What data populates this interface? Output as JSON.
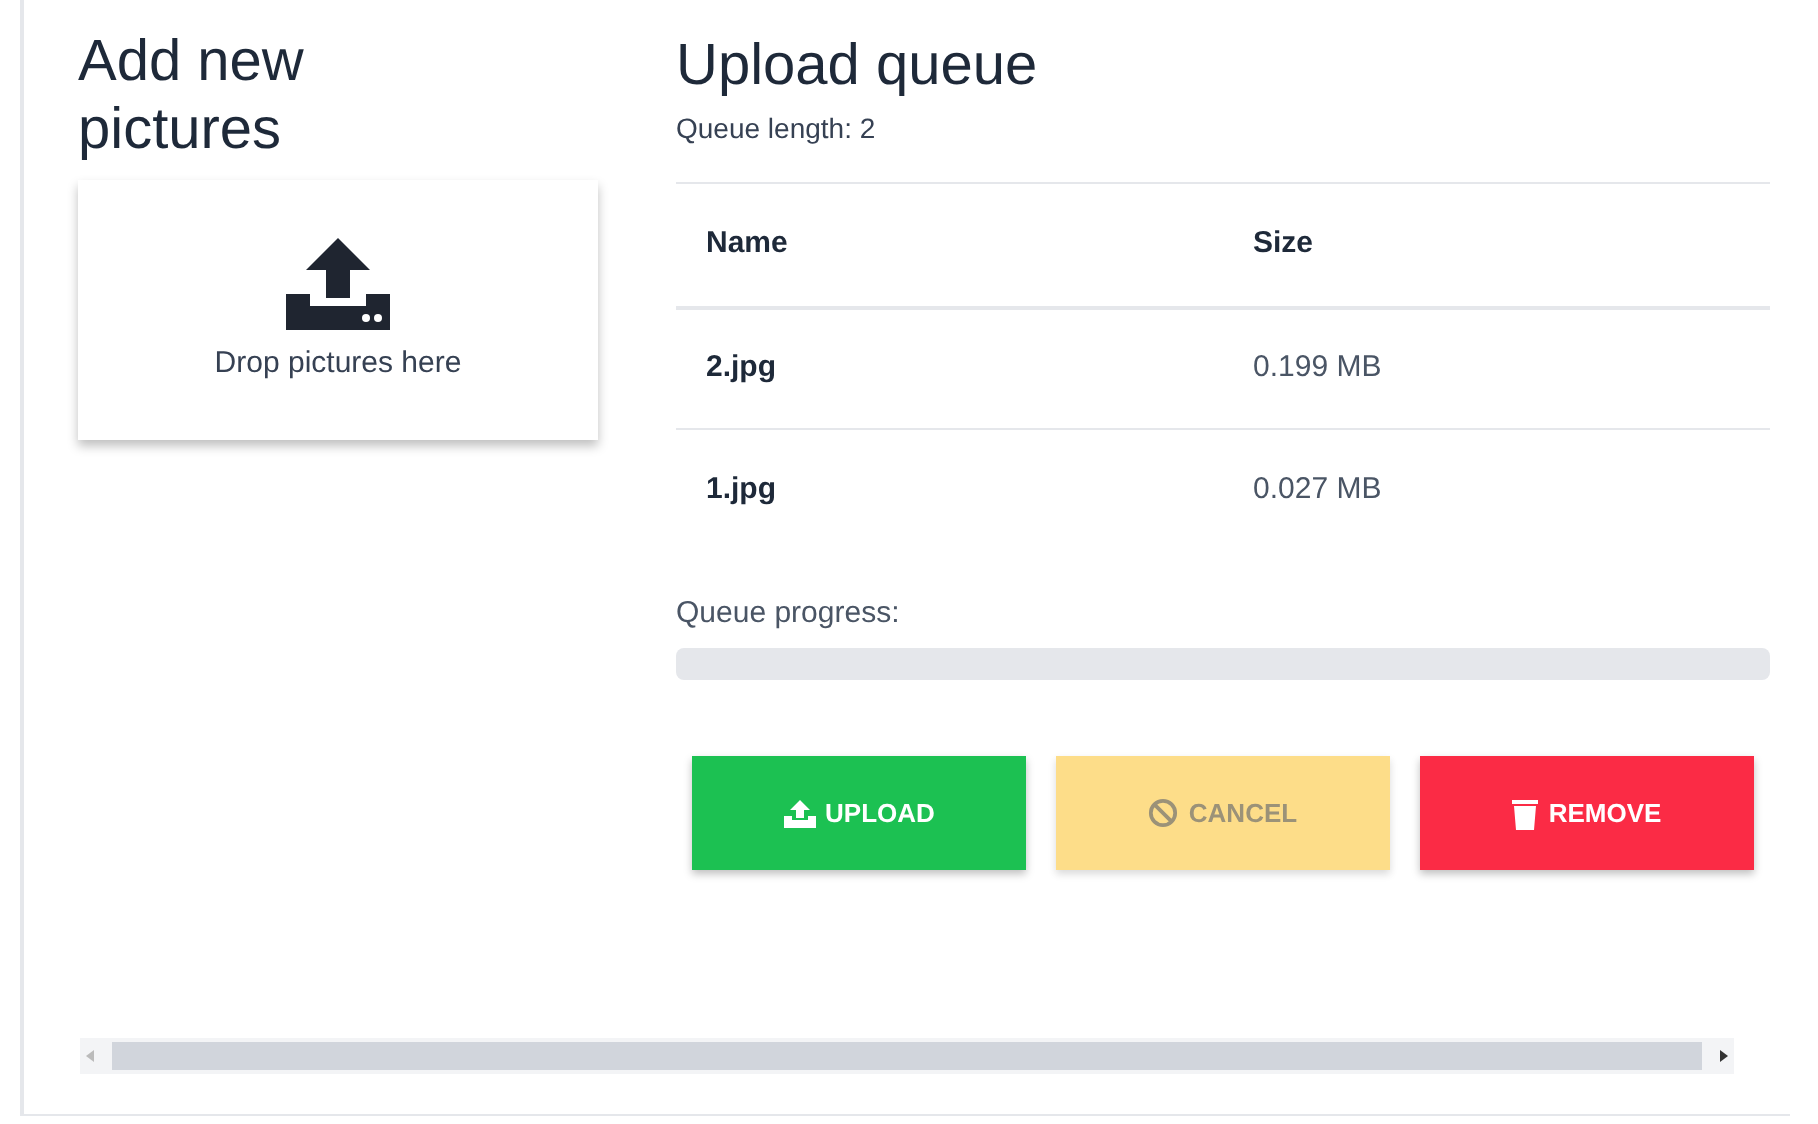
{
  "add_panel": {
    "title": "Add new pictures",
    "drop_zone": {
      "label": "Drop pictures here"
    }
  },
  "queue": {
    "title": "Upload queue",
    "length_label": "Queue length: 2",
    "columns": [
      "Name",
      "Size"
    ],
    "rows": [
      {
        "name": "2.jpg",
        "size": "0.199 MB"
      },
      {
        "name": "1.jpg",
        "size": "0.027 MB"
      }
    ],
    "progress_label": "Queue progress:",
    "progress": {
      "level": 0
    },
    "buttons": [
      {
        "kind": "upload",
        "label": "UPLOAD",
        "disabled": false
      },
      {
        "kind": "cancel",
        "label": "CANCEL",
        "disabled": true
      },
      {
        "kind": "remove",
        "label": "REMOVE",
        "disabled": false
      }
    ]
  }
}
